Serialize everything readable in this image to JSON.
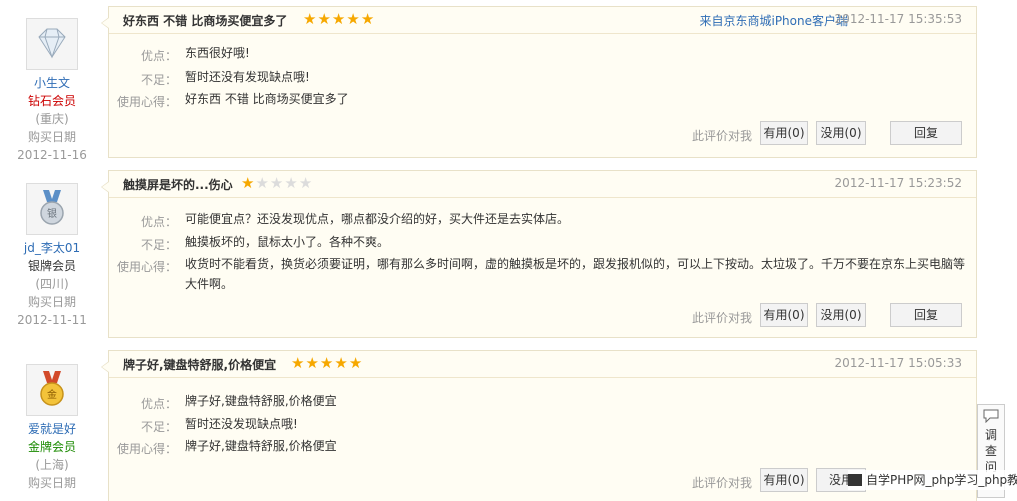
{
  "reviews": [
    {
      "user": {
        "name": "小生文",
        "level": "钻石会员",
        "location": "(重庆)",
        "buy_label": "购买日期",
        "buy_date": "2012-11-16",
        "avatar_icon": "diamond-icon"
      },
      "title": "好东西 不错 比商场买便宜多了",
      "rating": 5,
      "source": "来自京东商城iPhone客户端",
      "time": "2012-11-17 15:35:53",
      "pros_label": "优点：",
      "pros": "东西很好哦!",
      "cons_label": "不足：",
      "cons": "暂时还没有发现缺点哦!",
      "exp_label": "使用心得：",
      "experience": "好东西 不错 比商场买便宜多了",
      "action_label": "此评价对我",
      "useful": "有用(0)",
      "useless": "没用(0)",
      "reply": "回复"
    },
    {
      "user": {
        "name": "jd_李太01",
        "level": "银牌会员",
        "location": "(四川)",
        "buy_label": "购买日期",
        "buy_date": "2012-11-11",
        "avatar_icon": "silver-medal-icon"
      },
      "title": "触摸屏是坏的...伤心",
      "rating": 1,
      "source": "",
      "time": "2012-11-17 15:23:52",
      "pros_label": "优点：",
      "pros": "可能便宜点？还没发现优点，哪点都没介绍的好，买大件还是去实体店。",
      "cons_label": "不足：",
      "cons": "触摸板坏的，鼠标太小了。各种不爽。",
      "exp_label": "使用心得：",
      "experience": "收货时不能看货，换货必须要证明，哪有那么多时间啊，虚的触摸板是坏的，跟发报机似的，可以上下按动。太垃圾了。千万不要在京东上买电脑等大件啊。",
      "action_label": "此评价对我",
      "useful": "有用(0)",
      "useless": "没用(0)",
      "reply": "回复"
    },
    {
      "user": {
        "name": "爱就是好",
        "level": "金牌会员",
        "location": "(上海)",
        "buy_label": "购买日期",
        "buy_date": "",
        "avatar_icon": "gold-medal-icon"
      },
      "title": "牌子好,键盘特舒服,价格便宜",
      "rating": 5,
      "source": "",
      "time": "2012-11-17 15:05:33",
      "pros_label": "优点：",
      "pros": "牌子好,键盘特舒服,价格便宜",
      "cons_label": "不足：",
      "cons": "暂时还没发现缺点哦!",
      "exp_label": "使用心得：",
      "experience": "牌子好,键盘特舒服,价格便宜",
      "action_label": "此评价对我",
      "useful": "有用(0)",
      "useless": "没用",
      "reply": "回复"
    }
  ],
  "floating": {
    "feedback_text": "调查问",
    "icon": "chat-bubble-icon"
  },
  "watermark": {
    "text": "自学PHP网_php学习_php教"
  },
  "colors": {
    "star": "#f6a800",
    "link": "#2f6db5",
    "diamond": "#cc0000",
    "gold_level": "#1a8a00"
  }
}
